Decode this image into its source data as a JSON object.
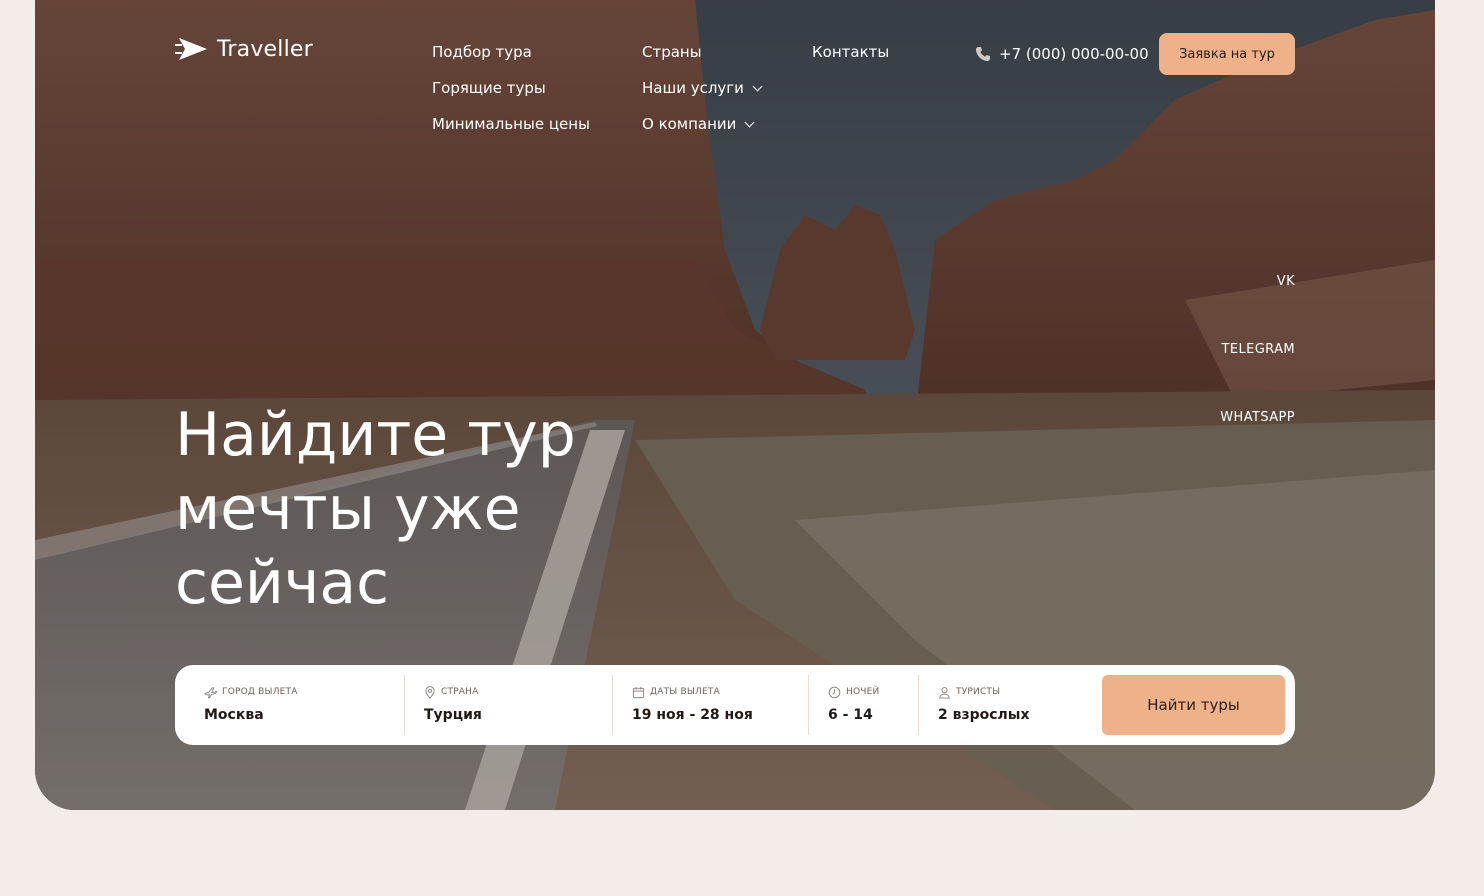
{
  "brand": {
    "name": "Traveller"
  },
  "nav": {
    "col1": [
      "Подбор тура",
      "Горящие туры",
      "Минимальные цены"
    ],
    "col2": [
      "Страны",
      "Наши услуги",
      "О компании"
    ],
    "col3": [
      "Контакты"
    ]
  },
  "header": {
    "phone": "+7 (000) 000-00-00",
    "cta": "Заявка на тур"
  },
  "social": [
    "VK",
    "TELEGRAM",
    "WHATSAPP"
  ],
  "hero": {
    "line1": "Найдите тур",
    "line2": "мечты уже",
    "line3": "сейчас"
  },
  "search": {
    "city_label": "ГОРОД ВЫЛЕТА",
    "city_value": "Москва",
    "country_label": "СТРАНА",
    "country_value": "Турция",
    "dates_label": "ДАТЫ ВЫЛЕТА",
    "dates_value": "19 ноя - 28 ноя",
    "nights_label": "НОЧЕЙ",
    "nights_value": "6 - 14",
    "tourists_label": "ТУРИСТЫ",
    "tourists_value": "2 взрослых",
    "submit": "Найти туры"
  },
  "colors": {
    "accent": "#eeb18a",
    "page_bg": "#f3ece9",
    "text_dark": "#231a16"
  },
  "icons": {
    "logo": "paper-plane-icon",
    "phone": "phone-icon",
    "city": "plane-icon",
    "country": "location-pin-icon",
    "dates": "calendar-icon",
    "nights": "clock-icon",
    "tourists": "user-icon"
  }
}
